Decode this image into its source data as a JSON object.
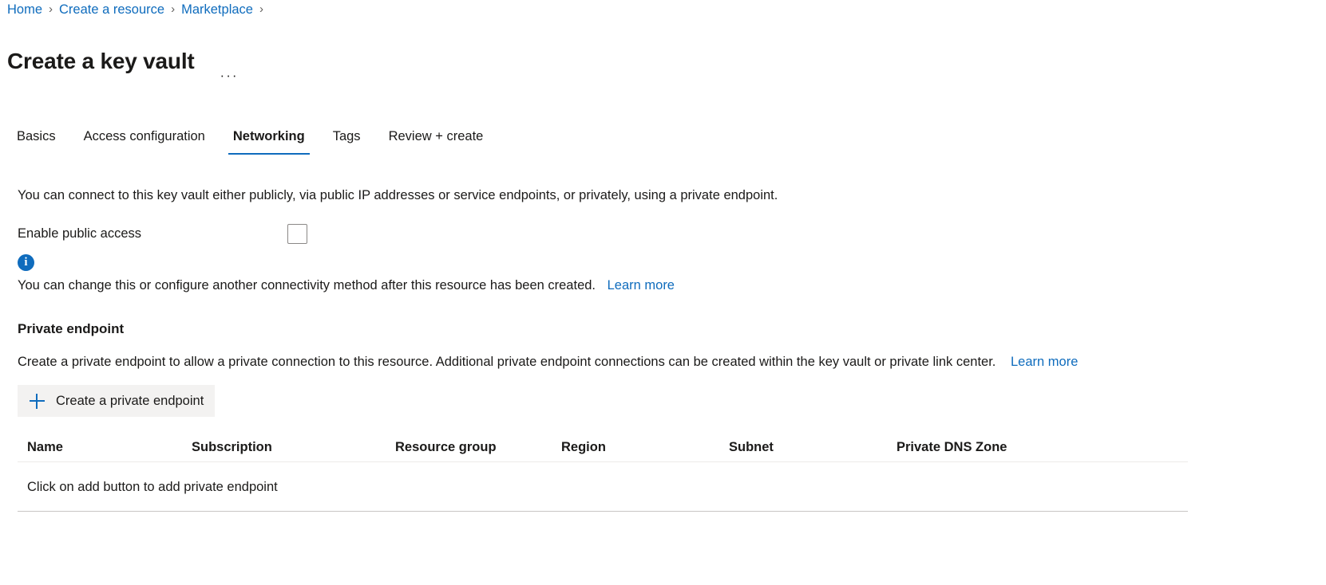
{
  "breadcrumb": {
    "items": [
      {
        "label": "Home"
      },
      {
        "label": "Create a resource"
      },
      {
        "label": "Marketplace"
      }
    ],
    "separator": "›"
  },
  "header": {
    "title": "Create a key vault",
    "more_actions": "···"
  },
  "tabs": [
    {
      "label": "Basics",
      "active": false
    },
    {
      "label": "Access configuration",
      "active": false
    },
    {
      "label": "Networking",
      "active": true
    },
    {
      "label": "Tags",
      "active": false
    },
    {
      "label": "Review + create",
      "active": false
    }
  ],
  "networking": {
    "intro": "You can connect to this key vault either publicly, via public IP addresses or service endpoints, or privately, using a private endpoint.",
    "enable_public_access": {
      "label": "Enable public access",
      "checked": false
    },
    "info": {
      "icon": "info-icon",
      "text": "You can change this or configure another connectivity method after this resource has been created.",
      "link_label": "Learn more"
    },
    "private_endpoint": {
      "section_title": "Private endpoint",
      "description": "Create a private endpoint to allow a private connection to this resource. Additional private endpoint connections can be created within the key vault or private link center.",
      "link_label": "Learn more",
      "create_button": {
        "label": "Create a private endpoint",
        "icon": "plus-icon"
      },
      "table": {
        "columns": [
          "Name",
          "Subscription",
          "Resource group",
          "Region",
          "Subnet",
          "Private DNS Zone"
        ],
        "rows": [],
        "empty_message": "Click on add button to add private endpoint"
      }
    }
  },
  "colors": {
    "link": "#0f6cbd",
    "accent": "#0f6cbd",
    "text": "#1b1a19",
    "button_bg": "#f3f2f1",
    "border": "#c8c6c4"
  }
}
